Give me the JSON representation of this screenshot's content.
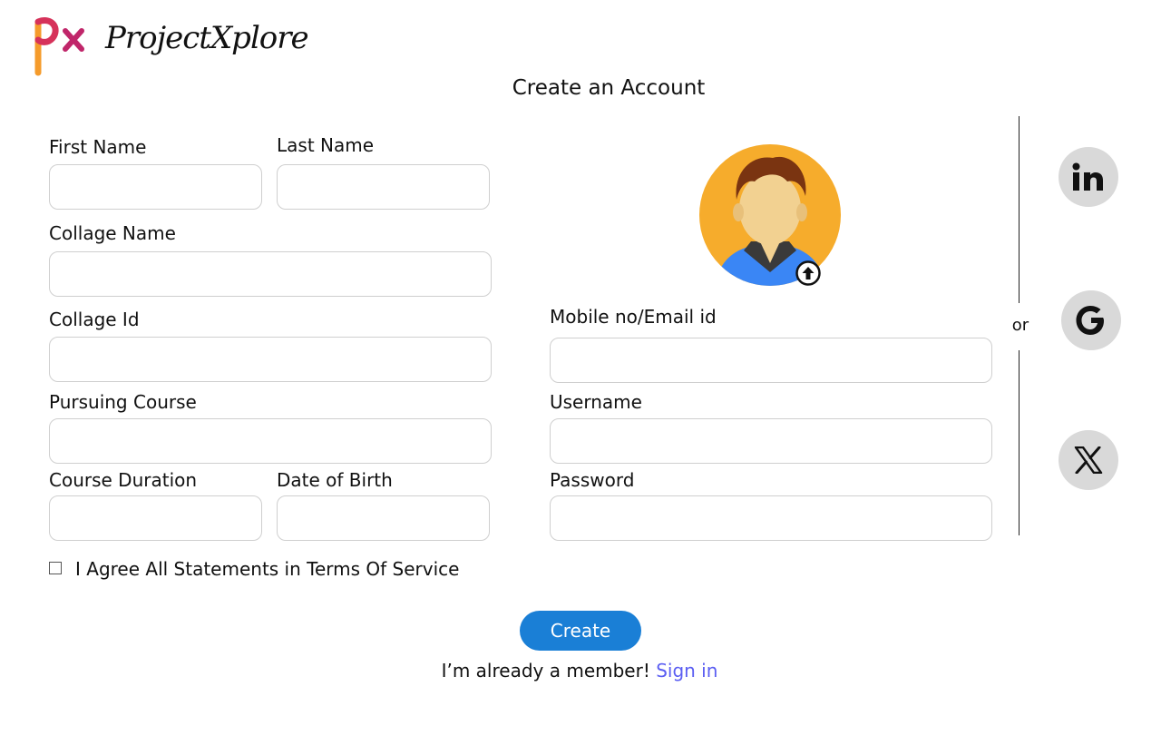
{
  "brand": {
    "name": "ProjectXplore",
    "mark": "px"
  },
  "page": {
    "title": "Create an Account"
  },
  "form": {
    "first_name": {
      "label": "First Name",
      "value": ""
    },
    "last_name": {
      "label": "Last Name",
      "value": ""
    },
    "college_name": {
      "label": "Collage Name",
      "value": ""
    },
    "college_id": {
      "label": "Collage Id",
      "value": ""
    },
    "course": {
      "label": "Pursuing Course",
      "value": ""
    },
    "duration": {
      "label": "Course Duration",
      "value": ""
    },
    "dob": {
      "label": "Date of Birth",
      "value": ""
    },
    "contact": {
      "label": "Mobile no/Email id",
      "value": ""
    },
    "username": {
      "label": "Username",
      "value": ""
    },
    "password": {
      "label": "Password",
      "value": ""
    },
    "terms": {
      "label": "I Agree All Statements in Terms Of Service",
      "checked": false
    },
    "submit_label": "Create"
  },
  "footer": {
    "member_text": "I’m already a member!",
    "signin_label": "Sign in"
  },
  "social": {
    "divider_text": "or",
    "icons": [
      "linkedin-icon",
      "google-icon",
      "x-icon"
    ]
  },
  "colors": {
    "accent": "#1a7fd6",
    "link": "#5b5ef2",
    "avatar_bg": "#f6ac2c",
    "social_bg": "#d9d9d9"
  }
}
